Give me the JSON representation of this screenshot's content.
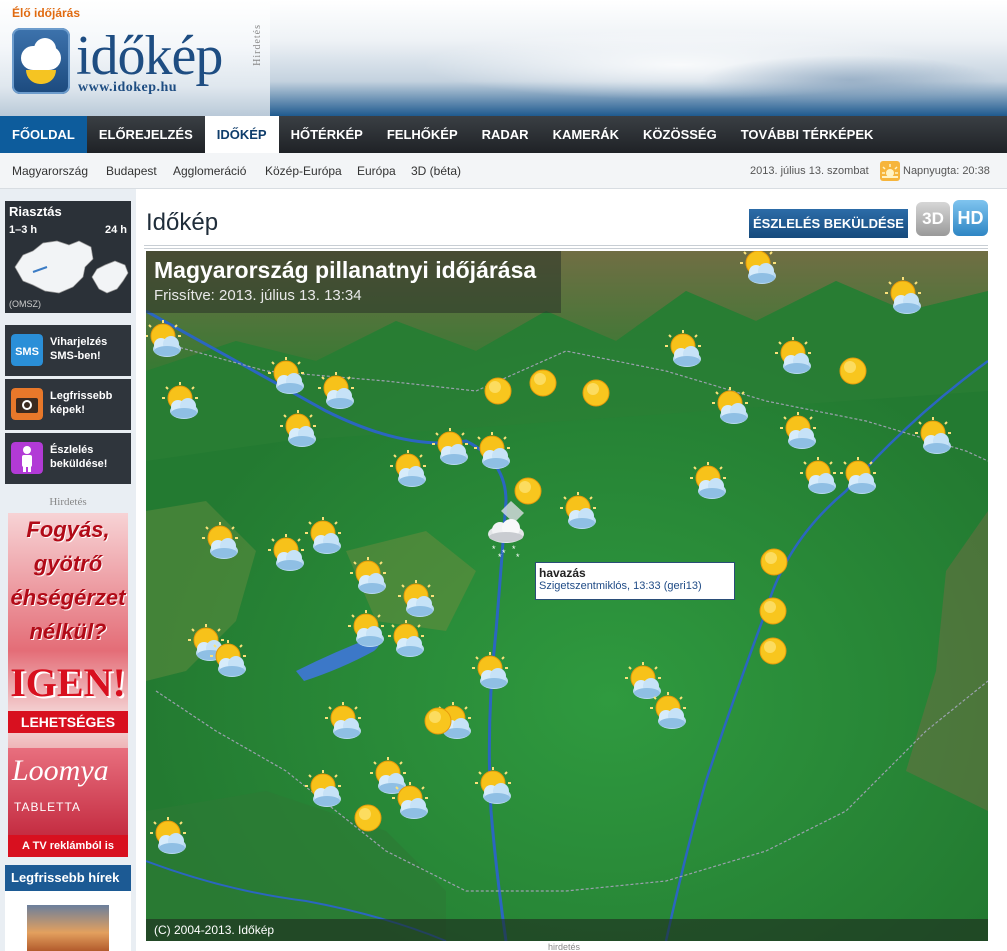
{
  "header": {
    "live_label": "Élő időjárás",
    "logo_text": "időkép",
    "logo_url": "www.idokep.hu",
    "ad_vertical": "Hirdetés"
  },
  "mainnav": {
    "items": [
      "FŐOLDAL",
      "ELŐREJELZÉS",
      "IDŐKÉP",
      "HŐTÉRKÉP",
      "FELHŐKÉP",
      "RADAR",
      "KAMERÁK",
      "KÖZÖSSÉG",
      "TOVÁBBI TÉRKÉPEK"
    ],
    "active": "IDŐKÉP"
  },
  "subnav": {
    "items": [
      "Magyarország",
      "Budapest",
      "Agglomeráció",
      "Közép-Európa",
      "Európa",
      "3D (béta)"
    ],
    "date": "2013. július 13. szombat",
    "sunset": "Napnyugta: 20:38"
  },
  "sidebar": {
    "alert_title": "Riasztás",
    "alert_range_short": "1–3 h",
    "alert_range_long": "24 h",
    "alert_source": "(OMSZ)",
    "boxes": [
      {
        "icon": "sms-icon",
        "text": "Viharjelzés SMS-ben!"
      },
      {
        "icon": "camera-icon",
        "text": "Legfrissebb képek!"
      },
      {
        "icon": "person-icon",
        "text": "Észlelés beküldése!"
      }
    ],
    "ad_label": "Hirdetés",
    "ad": {
      "line1": "Fogyás,",
      "line2": "gyötrő",
      "line3": "éhségérzet",
      "line4": "nélkül?",
      "igen": "IGEN!",
      "lehetseges": "LEHETSÉGES",
      "brand": "Loomya",
      "tablet": "TABLETTA",
      "tv": "A TV reklámból is ismert!"
    },
    "news_title": "Legfrissebb hírek"
  },
  "content": {
    "title": "Időkép",
    "report_button": "ÉSZLELÉS BEKÜLDÉSE",
    "btn_3d": "3D",
    "btn_hd": "HD",
    "map_title": "Magyarország pillanatnyi időjárása",
    "map_updated": "Frissítve: 2013. július 13. 13:34",
    "map_copyright": "(C) 2004-2013. Időkép",
    "tooltip_title": "havazás",
    "tooltip_detail": "Szigetszentmiklós, 13:33 (geri13)",
    "below_ad": "hirdetés"
  },
  "colors": {
    "nav_dark": "#1f2226",
    "nav_first": "#0d5c9c",
    "brand_blue": "#1e4d82",
    "live_orange": "#e06a10",
    "map_green": "#2f8a3a"
  }
}
